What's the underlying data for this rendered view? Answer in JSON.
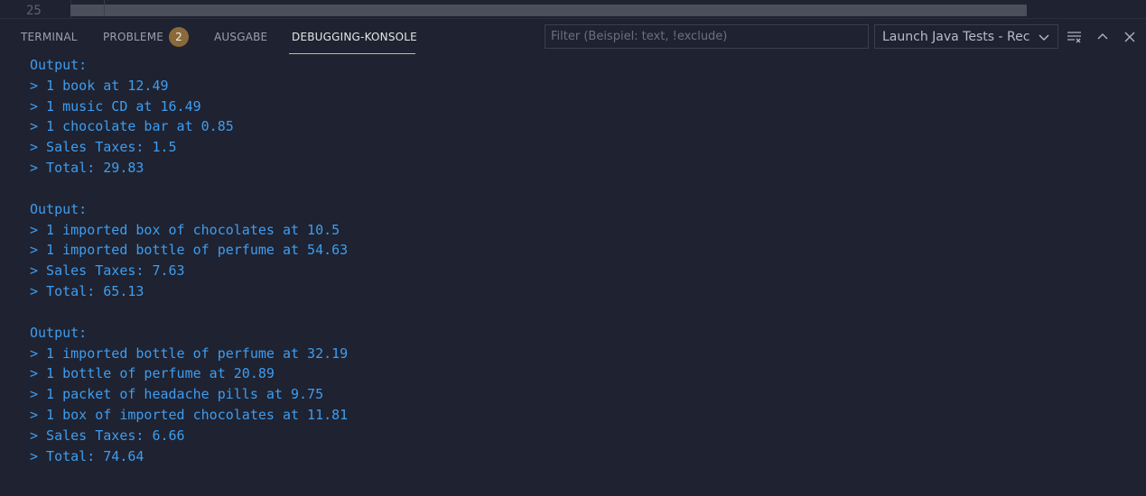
{
  "editor": {
    "line_number": "25"
  },
  "tabs": [
    {
      "label": "TERMINAL"
    },
    {
      "label": "PROBLEME",
      "badge": "2"
    },
    {
      "label": "AUSGABE"
    },
    {
      "label": "DEBUGGING-KONSOLE"
    }
  ],
  "filter": {
    "placeholder": "Filter (Beispiel: text, !exclude)",
    "value": ""
  },
  "launch_config": {
    "selected": "Launch Java Tests - Rec"
  },
  "icons": {
    "clear": "clear-all-icon",
    "maximize": "chevron-up-icon",
    "close": "close-icon"
  },
  "colors": {
    "accent": "#e0b65a",
    "output_text": "#3d9df0",
    "background": "#1f2230"
  },
  "console": {
    "blocks": [
      {
        "header": "Output:",
        "lines": [
          "> 1 book at 12.49",
          "> 1 music CD at 16.49",
          "> 1 chocolate bar at 0.85",
          "> Sales Taxes: 1.5",
          "> Total: 29.83"
        ]
      },
      {
        "header": "Output:",
        "lines": [
          "> 1 imported box of chocolates at 10.5",
          "> 1 imported bottle of perfume at 54.63",
          "> Sales Taxes: 7.63",
          "> Total: 65.13"
        ]
      },
      {
        "header": "Output:",
        "lines": [
          "> 1 imported bottle of perfume at 32.19",
          "> 1 bottle of perfume at 20.89",
          "> 1 packet of headache pills at 9.75",
          "> 1 box of imported chocolates at 11.81",
          "> Sales Taxes: 6.66",
          "> Total: 74.64"
        ]
      }
    ]
  }
}
